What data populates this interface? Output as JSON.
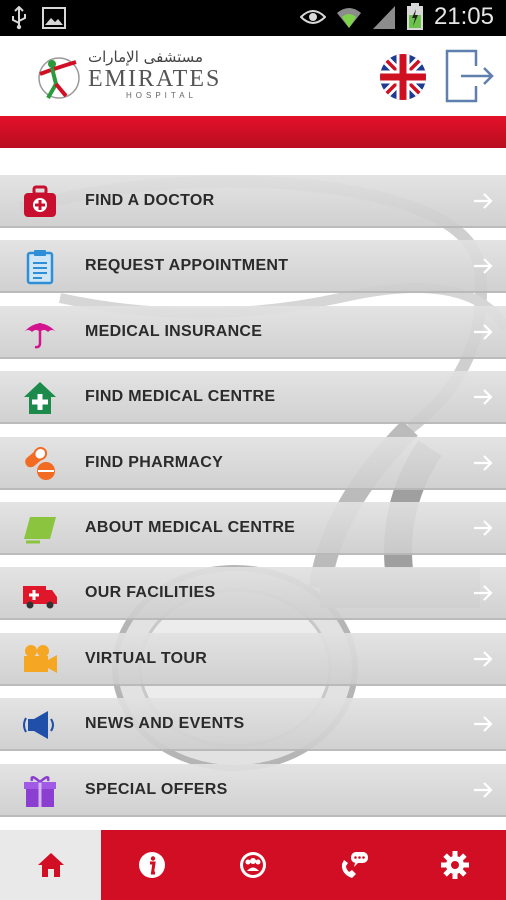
{
  "status_bar": {
    "time": "21:05",
    "icons": [
      "usb-icon",
      "image-icon",
      "eye-icon",
      "wifi-icon",
      "signal-icon",
      "battery-icon"
    ]
  },
  "header": {
    "logo_arabic": "مستشفى الإمارات",
    "logo_name": "EMIRATES",
    "logo_sub": "HOSPITAL",
    "language_icon": "uk-flag-icon",
    "exit_icon": "logout-icon"
  },
  "colors": {
    "brand_red": "#d10e24",
    "menu_text": "#2b2b2b"
  },
  "menu": [
    {
      "label": "FIND A DOCTOR",
      "icon": "medical-kit-icon"
    },
    {
      "label": "REQUEST APPOINTMENT",
      "icon": "clipboard-icon"
    },
    {
      "label": "MEDICAL INSURANCE",
      "icon": "umbrella-icon"
    },
    {
      "label": "FIND MEDICAL CENTRE",
      "icon": "medical-house-icon"
    },
    {
      "label": "FIND PHARMACY",
      "icon": "pills-icon"
    },
    {
      "label": "ABOUT MEDICAL CENTRE",
      "icon": "info-card-icon"
    },
    {
      "label": "OUR FACILITIES",
      "icon": "ambulance-icon"
    },
    {
      "label": "VIRTUAL TOUR",
      "icon": "video-camera-icon"
    },
    {
      "label": "NEWS AND EVENTS",
      "icon": "megaphone-icon"
    },
    {
      "label": "SPECIAL OFFERS",
      "icon": "gift-box-icon"
    }
  ],
  "bottom_nav": [
    {
      "name": "home",
      "icon": "home-icon",
      "active": true
    },
    {
      "name": "info",
      "icon": "info-icon",
      "active": false
    },
    {
      "name": "community",
      "icon": "group-icon",
      "active": false
    },
    {
      "name": "contact",
      "icon": "phone-chat-icon",
      "active": false
    },
    {
      "name": "settings",
      "icon": "gear-icon",
      "active": false
    }
  ]
}
